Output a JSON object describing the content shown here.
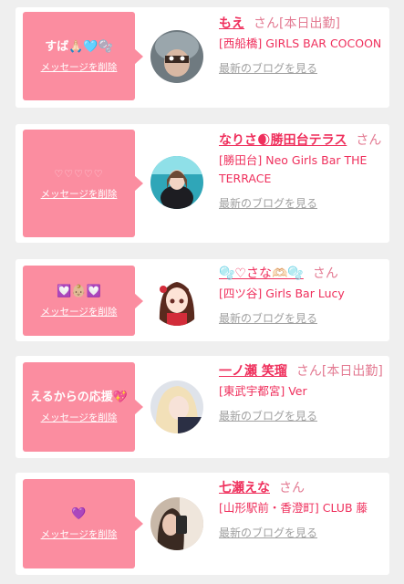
{
  "delete_label": "メッセージを削除",
  "blog_label": "最新のブログを見る",
  "san_label": "さん",
  "colors": {
    "accent": "#ef2f5c",
    "bubble": "#fb8da0",
    "background": "#efefef"
  },
  "items": [
    {
      "message": "すば🙏🏻🩵🫧",
      "name": "もえ",
      "san_suffix": "さん[本日出勤]",
      "shop": "[西船橋] GIRLS BAR COCOON",
      "avatar_icon": "photo-avatar"
    },
    {
      "message": "♡♡♡♡♡",
      "name": "なりさ🌒勝田台テラス",
      "san_suffix": "さん",
      "shop": "[勝田台] Neo Girls Bar THE TERRACE",
      "avatar_icon": "photo-avatar"
    },
    {
      "message": "💟👶🏼💟",
      "name": "🫧♡さな🫶🏻🫧",
      "san_suffix": "さん",
      "shop": "[四ツ谷] Girls Bar Lucy",
      "avatar_icon": "anime-avatar"
    },
    {
      "message": "えるからの応援💖",
      "name": "一ノ瀬 笑瑠",
      "san_suffix": "さん[本日出勤]",
      "shop": "[東武宇都宮] Ver",
      "avatar_icon": "photo-avatar"
    },
    {
      "message": "💜",
      "name": "七瀬えな",
      "san_suffix": "さん",
      "shop": "[山形駅前・香澄町] CLUB 藤",
      "avatar_icon": "photo-avatar"
    }
  ]
}
